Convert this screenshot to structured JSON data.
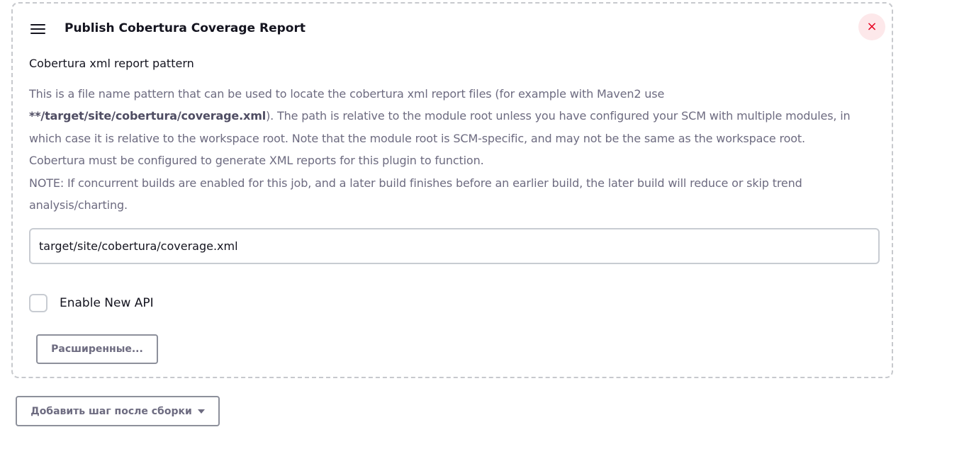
{
  "step": {
    "title": "Publish Cobertura Coverage Report",
    "close_icon": "×",
    "field_label": "Cobertura xml report pattern",
    "help": {
      "p1_before": "This is a file name pattern that can be used to locate the cobertura xml report files (for example with Maven2 use ",
      "p1_bold": "**/target/site/cobertura/coverage.xml",
      "p1_after": "). The path is relative to the module root unless you have configured your SCM with multiple modules, in which case it is relative to the workspace root. Note that the module root is SCM-specific, and may not be the same as the workspace root.",
      "p2": "Cobertura must be configured to generate XML reports for this plugin to function.",
      "p3": "NOTE: If concurrent builds are enabled for this job, and a later build finishes before an earlier build, the later build will reduce or skip trend analysis/charting."
    },
    "input_value": "target/site/cobertura/coverage.xml",
    "checkbox_label": "Enable New API",
    "checkbox_checked": false,
    "advanced_label": "Расширенные..."
  },
  "add_step_label": "Добавить шаг после сборки",
  "colors": {
    "close_bg": "#fde8ea",
    "close_fg": "#e6001f",
    "help_text": "#6d6b80",
    "border_dashed": "#c7c9cd"
  },
  "icons": {
    "drag": "hamburger-icon",
    "close": "close-icon",
    "dropdown": "caret-down-icon"
  }
}
